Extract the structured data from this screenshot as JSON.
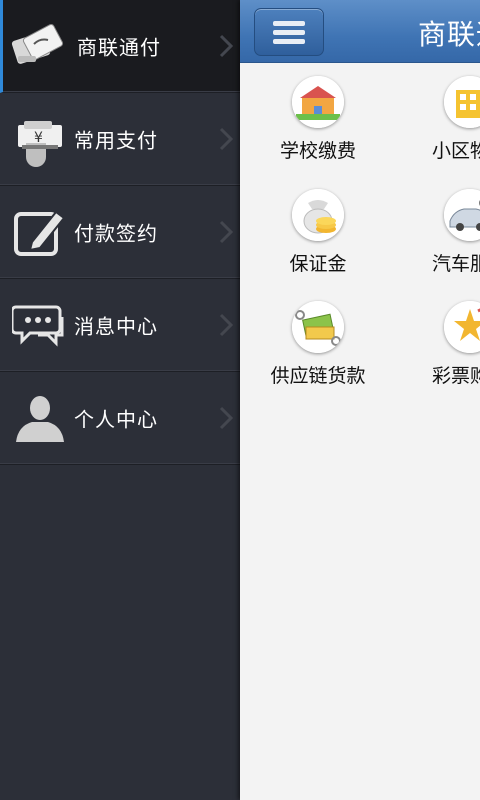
{
  "sidebar": {
    "items": [
      {
        "label": "商联通付",
        "icon": "cards-icon",
        "active": true
      },
      {
        "label": "常用支付",
        "icon": "hand-yen-card-icon",
        "active": false
      },
      {
        "label": "付款签约",
        "icon": "pen-edit-icon",
        "active": false
      },
      {
        "label": "消息中心",
        "icon": "chat-bubbles-icon",
        "active": false
      },
      {
        "label": "个人中心",
        "icon": "person-icon",
        "active": false
      }
    ]
  },
  "header": {
    "title": "商联通付"
  },
  "main": {
    "services": [
      {
        "label": "学校缴费",
        "icon": "school-icon"
      },
      {
        "label": "小区物业",
        "icon": "residence-icon"
      },
      {
        "label": "保证金",
        "icon": "coin-bag-icon"
      },
      {
        "label": "汽车服务",
        "icon": "car-icon"
      },
      {
        "label": "供应链货款",
        "icon": "cash-chain-icon"
      },
      {
        "label": "彩票购买",
        "icon": "lottery-icon"
      }
    ]
  },
  "colors": {
    "accent": "#2f89d9",
    "header_blue": "#3f74b4",
    "sidebar_bg": "#2c2f38"
  }
}
